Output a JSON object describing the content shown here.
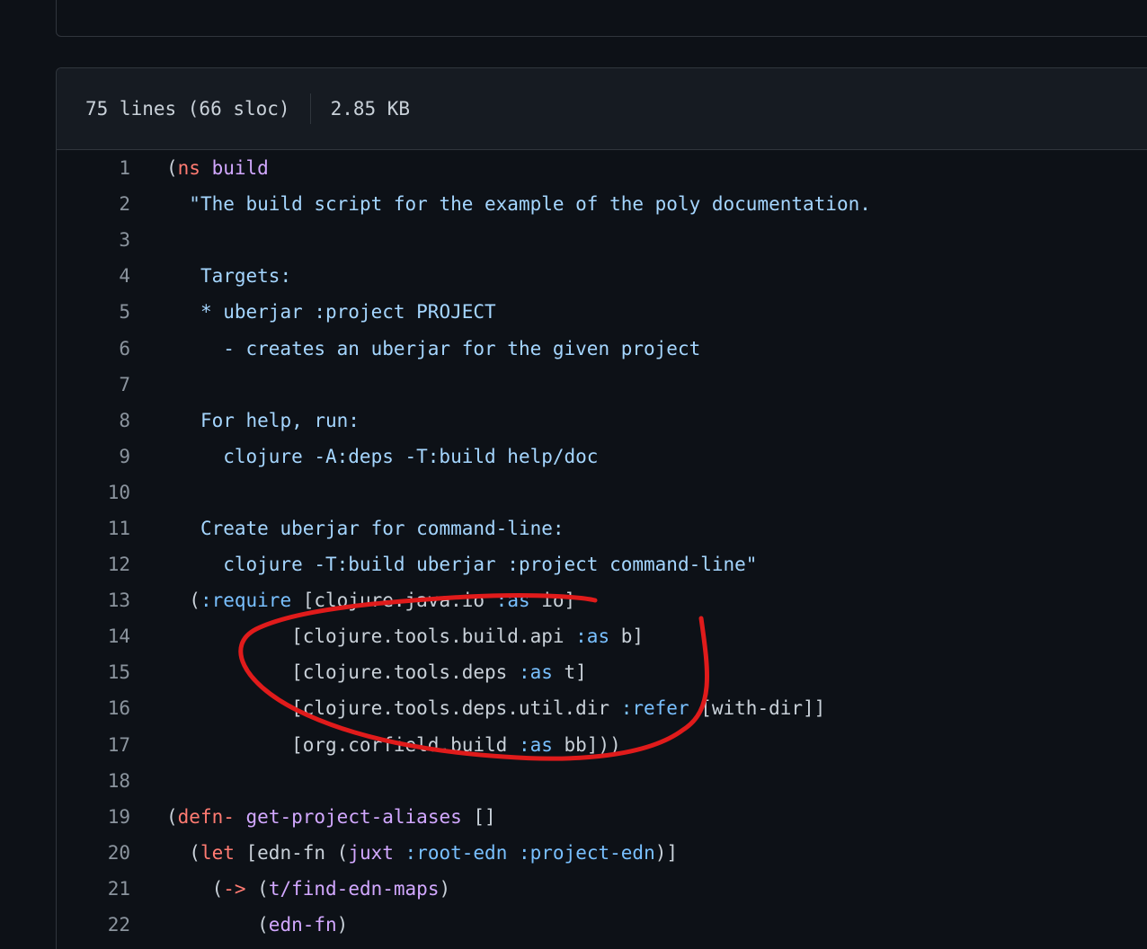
{
  "file": {
    "lines_info": "75 lines (66 sloc)",
    "size": "2.85 KB"
  },
  "code_lines": [
    {
      "n": "1",
      "t": [
        [
          "(",
          ""
        ],
        [
          "ns",
          "k"
        ],
        [
          " ",
          ""
        ],
        [
          "build",
          "f"
        ]
      ]
    },
    {
      "n": "2",
      "t": [
        [
          "  ",
          ""
        ],
        [
          "\"The build script for the example of the poly documentation.",
          "s"
        ]
      ]
    },
    {
      "n": "3",
      "t": []
    },
    {
      "n": "4",
      "t": [
        [
          "   ",
          ""
        ],
        [
          "Targets:",
          "s"
        ]
      ]
    },
    {
      "n": "5",
      "t": [
        [
          "   ",
          ""
        ],
        [
          "* uberjar :project PROJECT",
          "s"
        ]
      ]
    },
    {
      "n": "6",
      "t": [
        [
          "     ",
          ""
        ],
        [
          "- creates an uberjar for the given project",
          "s"
        ]
      ]
    },
    {
      "n": "7",
      "t": []
    },
    {
      "n": "8",
      "t": [
        [
          "   ",
          ""
        ],
        [
          "For help, run:",
          "s"
        ]
      ]
    },
    {
      "n": "9",
      "t": [
        [
          "     ",
          ""
        ],
        [
          "clojure -A:deps -T:build help/doc",
          "s"
        ]
      ]
    },
    {
      "n": "10",
      "t": []
    },
    {
      "n": "11",
      "t": [
        [
          "   ",
          ""
        ],
        [
          "Create uberjar for command-line:",
          "s"
        ]
      ]
    },
    {
      "n": "12",
      "t": [
        [
          "     ",
          ""
        ],
        [
          "clojure -T:build uberjar :project command-line\"",
          "s"
        ]
      ]
    },
    {
      "n": "13",
      "t": [
        [
          "  (",
          ""
        ],
        [
          ":require",
          "c"
        ],
        [
          " [clojure.java.io ",
          ""
        ],
        [
          ":as",
          "c"
        ],
        [
          " io]",
          ""
        ]
      ]
    },
    {
      "n": "14",
      "t": [
        [
          "           [clojure.tools.build.api ",
          ""
        ],
        [
          ":as",
          "c"
        ],
        [
          " b]",
          ""
        ]
      ]
    },
    {
      "n": "15",
      "t": [
        [
          "           [clojure.tools.deps ",
          ""
        ],
        [
          ":as",
          "c"
        ],
        [
          " t]",
          ""
        ]
      ]
    },
    {
      "n": "16",
      "t": [
        [
          "           [clojure.tools.deps.util.dir ",
          ""
        ],
        [
          ":refer",
          "c"
        ],
        [
          " [with-dir]]",
          ""
        ]
      ]
    },
    {
      "n": "17",
      "t": [
        [
          "           [org.corfield.build ",
          ""
        ],
        [
          ":as",
          "c"
        ],
        [
          " bb]))",
          ""
        ]
      ]
    },
    {
      "n": "18",
      "t": []
    },
    {
      "n": "19",
      "t": [
        [
          "(",
          ""
        ],
        [
          "defn-",
          "k"
        ],
        [
          " ",
          ""
        ],
        [
          "get-project-aliases",
          "f"
        ],
        [
          " []",
          ""
        ]
      ]
    },
    {
      "n": "20",
      "t": [
        [
          "  (",
          ""
        ],
        [
          "let",
          "k"
        ],
        [
          " [edn-fn (",
          ""
        ],
        [
          "juxt",
          "f"
        ],
        [
          " ",
          ""
        ],
        [
          ":root-edn",
          "c"
        ],
        [
          " ",
          ""
        ],
        [
          ":project-edn",
          "c"
        ],
        [
          ")]",
          ""
        ]
      ]
    },
    {
      "n": "21",
      "t": [
        [
          "    (",
          ""
        ],
        [
          "->",
          "k"
        ],
        [
          " (",
          ""
        ],
        [
          "t/find-edn-maps",
          "f"
        ],
        [
          ")",
          ""
        ]
      ]
    },
    {
      "n": "22",
      "t": [
        [
          "        (",
          ""
        ],
        [
          "edn-fn",
          "f"
        ],
        [
          ")",
          ""
        ]
      ]
    }
  ],
  "colors": {
    "background": "#0d1117",
    "header_bg": "#161b22",
    "border": "#30363d",
    "keyword": "#ff7b72",
    "function": "#d2a8ff",
    "string": "#a5d6ff",
    "constant": "#79c0ff",
    "annotation": "#e01b1b"
  }
}
